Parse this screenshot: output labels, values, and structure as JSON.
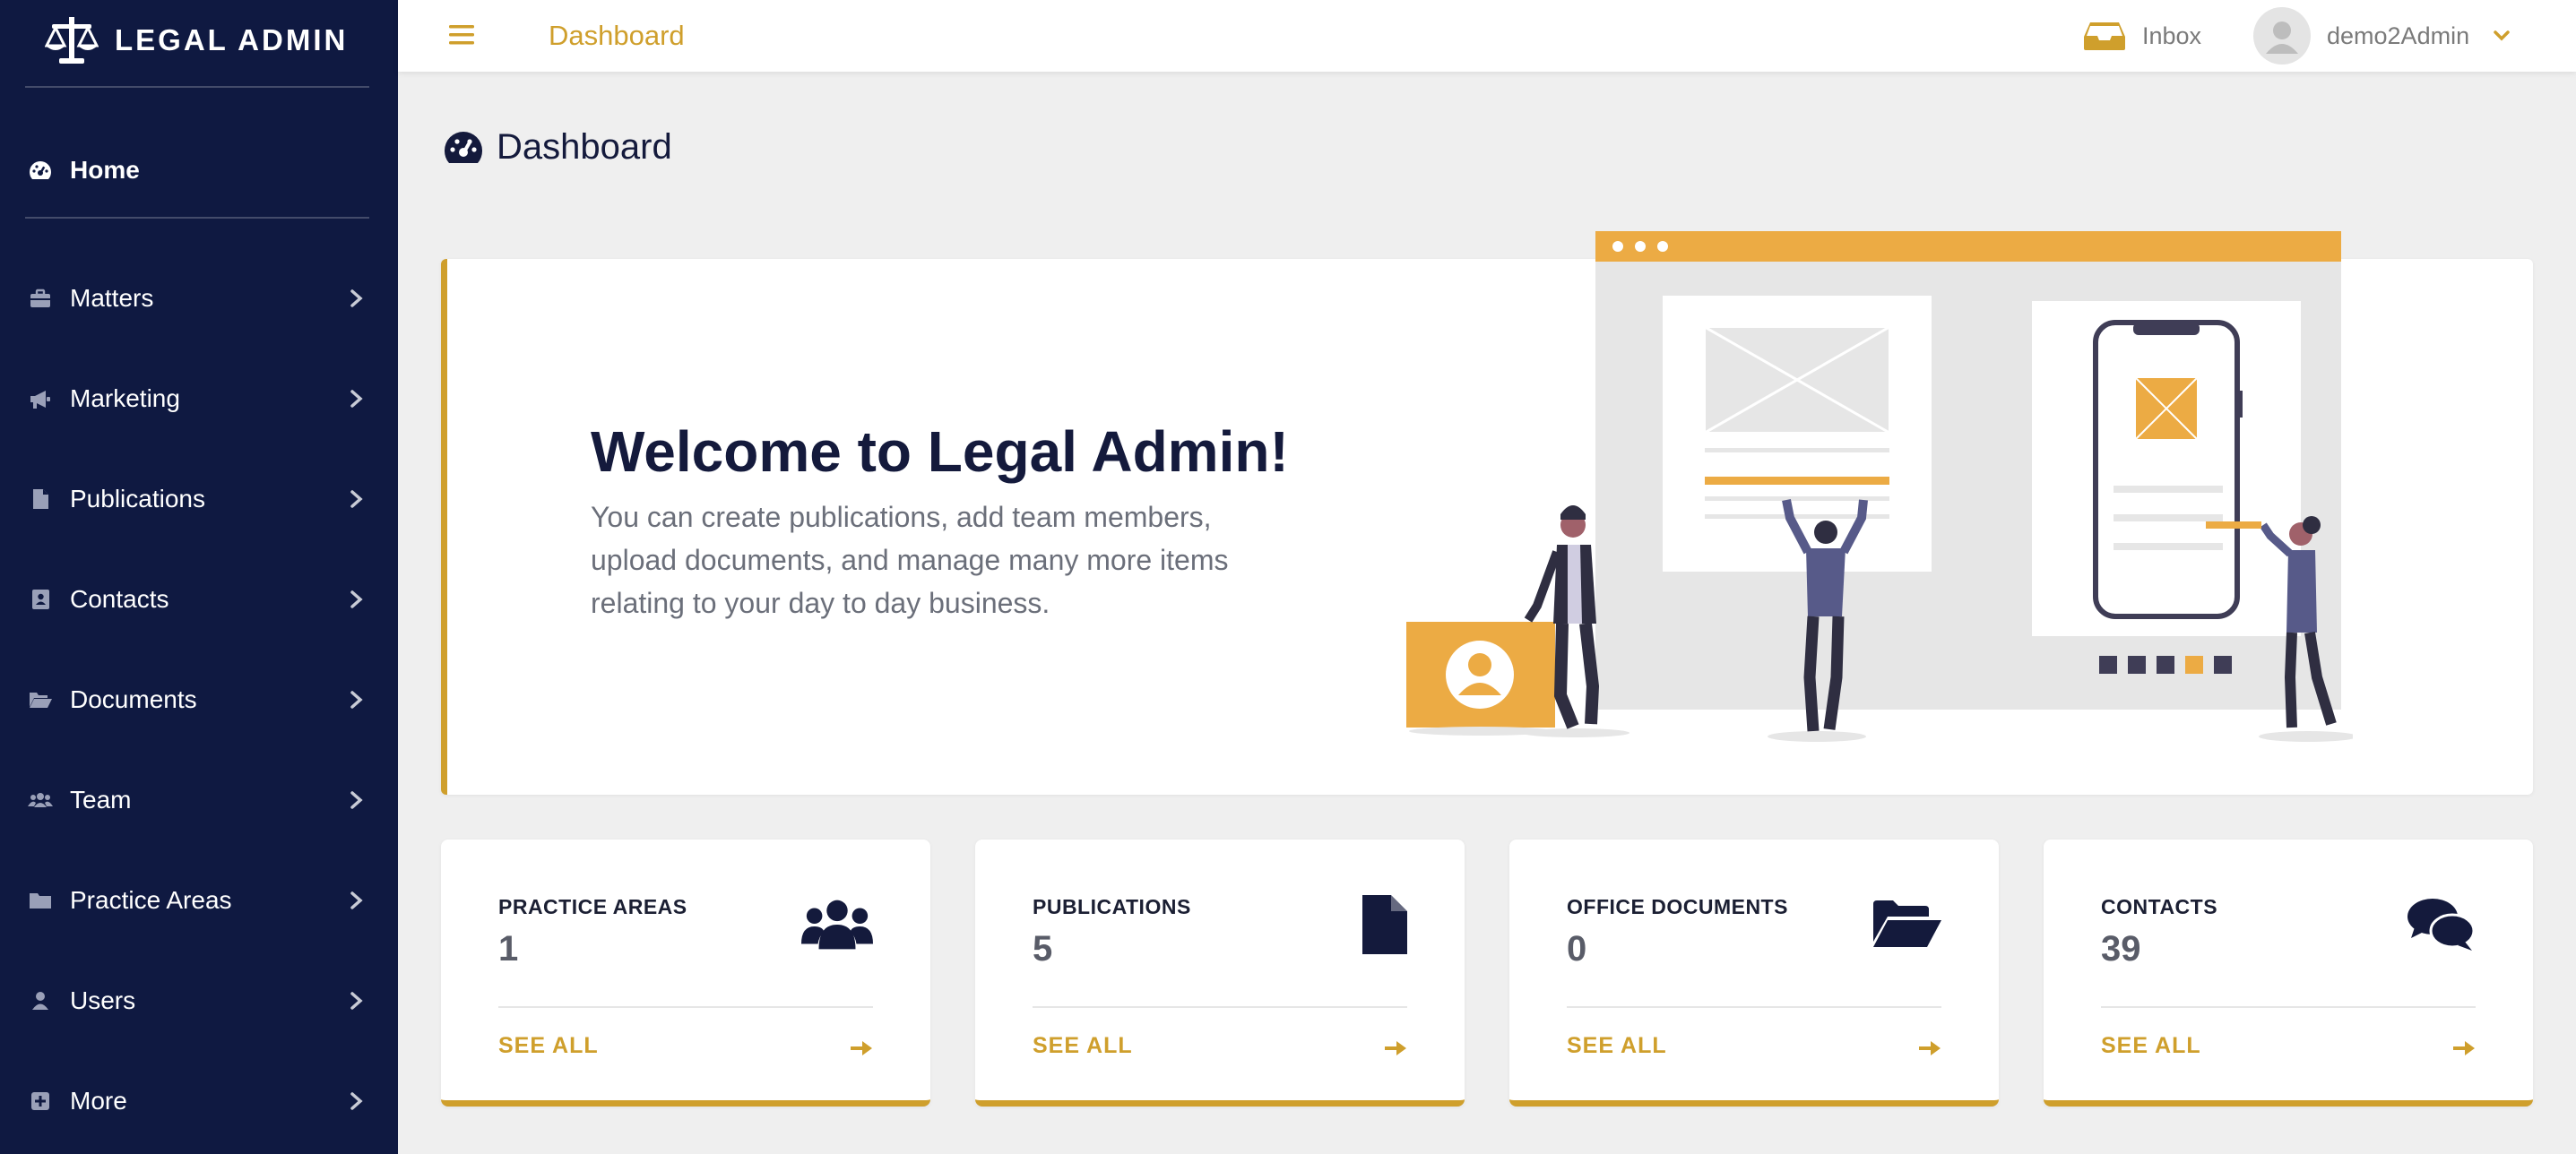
{
  "brand": {
    "name": "LEGAL ADMIN",
    "icon": "scales-icon"
  },
  "sidebar": {
    "home": {
      "label": "Home",
      "icon": "dashboard-icon"
    },
    "items": [
      {
        "label": "Matters",
        "icon": "briefcase-icon"
      },
      {
        "label": "Marketing",
        "icon": "bullhorn-icon"
      },
      {
        "label": "Publications",
        "icon": "file-icon"
      },
      {
        "label": "Contacts",
        "icon": "address-book-icon"
      },
      {
        "label": "Documents",
        "icon": "folder-open-icon"
      },
      {
        "label": "Team",
        "icon": "users-icon"
      },
      {
        "label": "Practice Areas",
        "icon": "folder-icon"
      },
      {
        "label": "Users",
        "icon": "user-icon"
      },
      {
        "label": "More",
        "icon": "plus-square-icon"
      }
    ]
  },
  "header": {
    "title": "Dashboard",
    "inbox_label": "Inbox",
    "user_name": "demo2Admin"
  },
  "page": {
    "title": "Dashboard"
  },
  "welcome": {
    "title": "Welcome to Legal Admin!",
    "text": "You can create publications, add team members, upload documents, and manage many more items relating to your day to day business."
  },
  "stats": [
    {
      "label": "PRACTICE AREAS",
      "value": "1",
      "link": "SEE ALL",
      "icon": "users-icon"
    },
    {
      "label": "PUBLICATIONS",
      "value": "5",
      "link": "SEE ALL",
      "icon": "file-icon"
    },
    {
      "label": "OFFICE DOCUMENTS",
      "value": "0",
      "link": "SEE ALL",
      "icon": "folder-open-icon"
    },
    {
      "label": "CONTACTS",
      "value": "39",
      "link": "SEE ALL",
      "icon": "comments-icon"
    }
  ],
  "colors": {
    "sidebar_bg": "#0f1941",
    "accent": "#cf9f2c",
    "illustration_yellow": "#ecab44",
    "text_dark": "#141a3c"
  }
}
